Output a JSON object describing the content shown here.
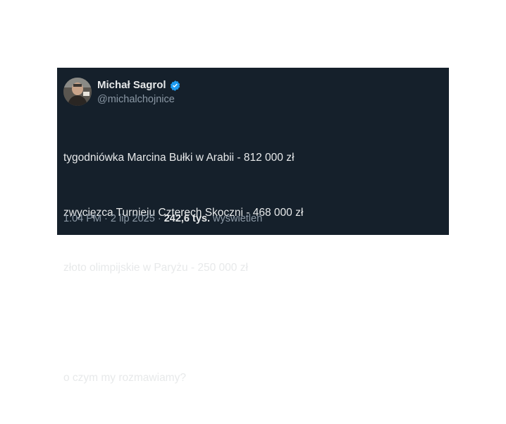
{
  "tweet": {
    "author": {
      "display_name": "Michał Sagrol",
      "handle": "@michalchojnice",
      "verified": true,
      "verified_badge_color": "#1d9bf0"
    },
    "text_lines": [
      "tygodniówka Marcina Bułki w Arabii - 812 000 zł",
      "zwycięzca Turnieju Czterech Skoczni - 468 000 zł",
      "złoto olimpijskie w Paryżu - 250 000 zł",
      "",
      "o czym my rozmawiamy?"
    ],
    "meta": {
      "time": "1:04 PM",
      "separator": "·",
      "date": "2 lip 2025",
      "views_count": "242,6 tys.",
      "views_label": "wyświetleń"
    }
  },
  "colors": {
    "card_background": "#15202b",
    "primary_text": "#e7e9ea",
    "secondary_text": "#8b98a5"
  }
}
